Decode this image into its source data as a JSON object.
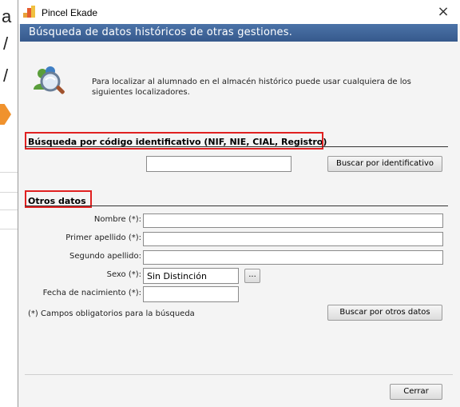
{
  "background": {
    "fragments": [
      "a",
      "/",
      "/"
    ]
  },
  "window": {
    "title": "Pincel Ekade",
    "close_symbol": "×",
    "header": "Búsqueda de datos históricos de otras gestiones."
  },
  "intro": {
    "text": "Para localizar al alumnado en el almacén histórico puede usar cualquiera de los siguientes localizadores."
  },
  "section_id": {
    "title": "Búsqueda por código identificativo (NIF, NIE, CIAL, Registro)",
    "input_value": "",
    "button_label": "Buscar por identificativo"
  },
  "section_other": {
    "title": "Otros datos",
    "fields": {
      "nombre": {
        "label": "Nombre (*):",
        "value": ""
      },
      "primer_apellido": {
        "label": "Primer apellido (*):",
        "value": ""
      },
      "segundo_apellido": {
        "label": "Segundo apellido:",
        "value": ""
      },
      "sexo": {
        "label": "Sexo (*):",
        "value": "Sin Distinción",
        "picker_label": "..."
      },
      "fecha": {
        "label": "Fecha de nacimiento (*):",
        "value": ""
      }
    },
    "note": "(*) Campos obligatorios para la búsqueda",
    "button_label": "Buscar por otros datos"
  },
  "footer": {
    "close_label": "Cerrar"
  },
  "colors": {
    "header_bar": "#4068a0",
    "highlight_box": "#e02020",
    "background_arrow": "#f0922d"
  },
  "icons": {
    "app": "pincel-ekade-icon",
    "info": "search-users-icon",
    "close": "close-icon"
  }
}
